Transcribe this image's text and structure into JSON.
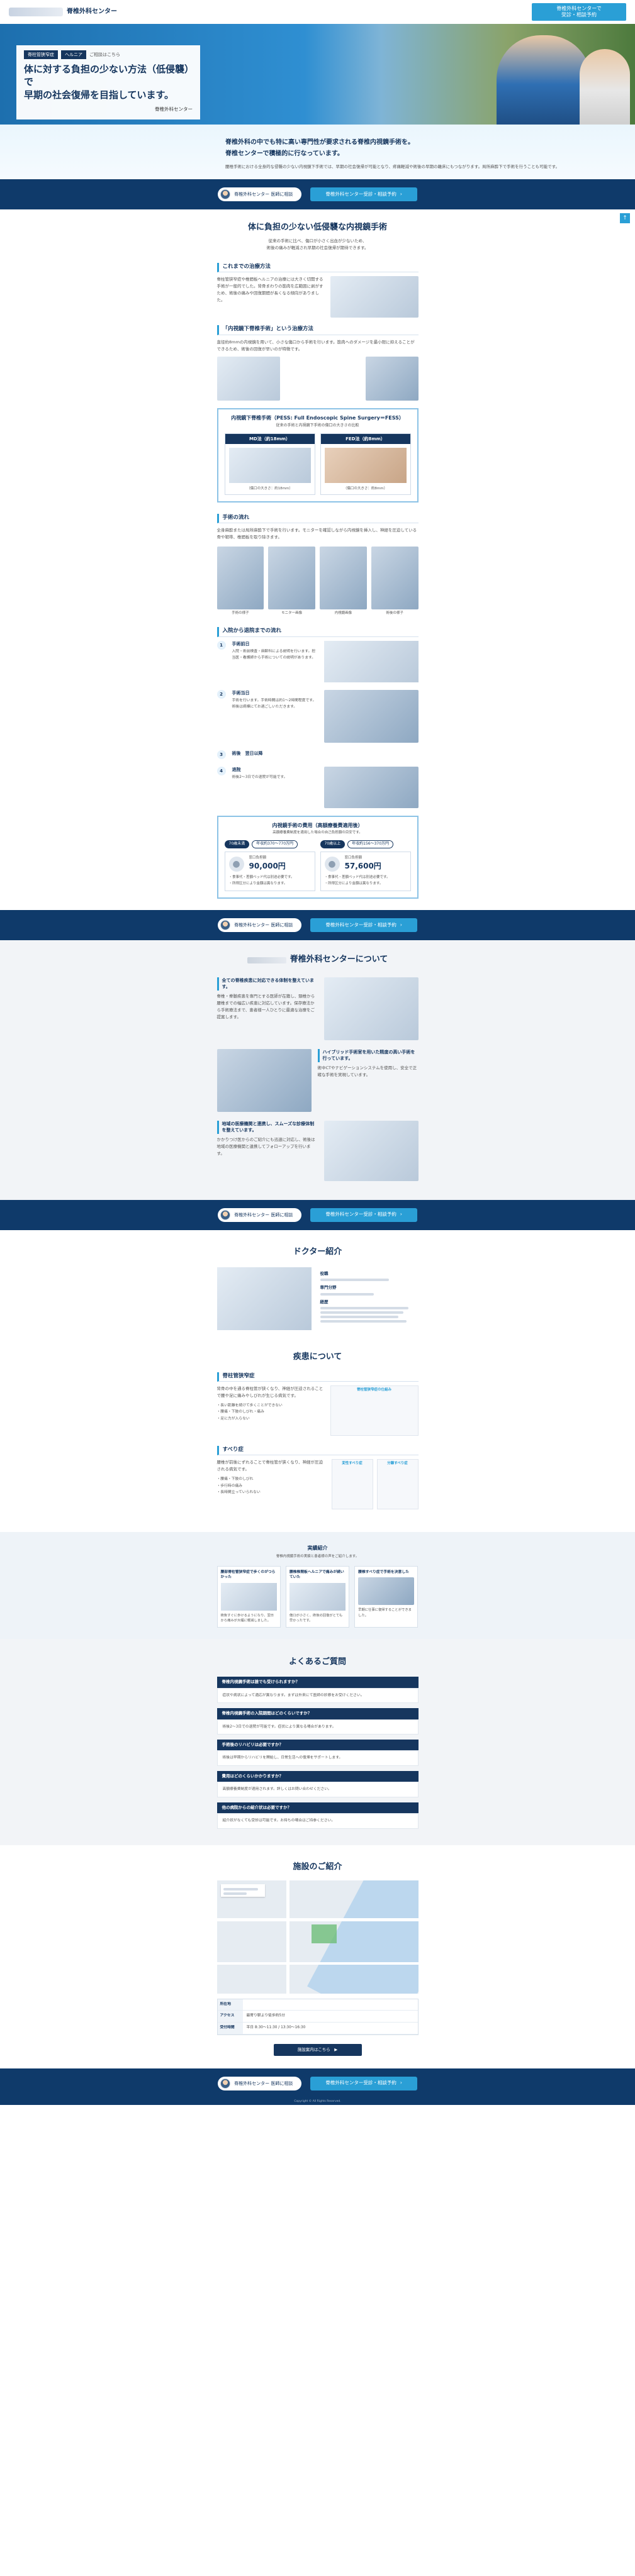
{
  "header": {
    "brand": "脊椎外科センター",
    "cta": "脊椎外科センターで\n受診・相談予約",
    "float_top": "↑"
  },
  "hero": {
    "tags": [
      "脊柱管狭窄症",
      "ヘルニア",
      "内視鏡手術"
    ],
    "tag_caption": "ご相談はこちら",
    "title": "体に対する負担の少ない方法（低侵襲）で\n早期の社会復帰を目指しています。",
    "footer": "脊椎外科センター"
  },
  "intro": {
    "lead": "脊椎外科の中でも特に高い専門性が要求される脊椎内視鏡手術を。\n脊椎センターで積極的に行なっています。",
    "body": "腰椎手術における全身的な侵襲の少ない内視鏡下手術では、早期の社会復帰が可能となり、疼痛軽減や術後の早期の離床にもつながります。局所麻酔下で手術を行うことも可能です。"
  },
  "cta": {
    "left": "脊椎外科センター 医師に相談",
    "right": "脊椎外科センター受診・相談予約"
  },
  "surgery": {
    "title": "体に負担の少ない低侵襲な内視鏡手術",
    "subtitle": "従来の手術に比べ、傷口が小さく出血が少ないため、\n術後の痛みが軽減され早期の社会復帰が期待できます。",
    "old_title": "これまでの治療方法",
    "old_text": "脊柱管狭窄症や椎間板ヘルニアの治療には大きく切開する手術が一般的でした。背骨まわりの筋肉を広範囲に剥がすため、術後の痛みや回復期間が長くなる傾向がありました。",
    "endo_title": "「内視鏡下脊椎手術」という治療方法",
    "endo_text": "直径約8mmの内視鏡を用いて、小さな傷口から手術を行います。筋肉へのダメージを最小限に抑えることができるため、術後の回復が早いのが特徴です。",
    "compare_title": "内視鏡下脊椎手術（PESS: Full Endoscopic Spine Surgery＝FESS）",
    "compare_sub": "従来の手術と内視鏡下手術の傷口の大きさの比較",
    "col1": "MD法（約18mm）",
    "col2": "FED法（約8mm）",
    "col1_cap": "（傷口の大きさ：約18mm）",
    "col2_cap": "（傷口の大きさ：約8mm）",
    "flow_title": "手術の流れ",
    "flow_text": "全身麻酔または局所麻酔下で手術を行います。モニターを確認しながら内視鏡を挿入し、神経を圧迫している骨や靭帯、椎間板を取り除きます。",
    "flow_caps": [
      "手術の様子",
      "モニター画像",
      "内視鏡画像",
      "術後の様子"
    ]
  },
  "steps": {
    "title": "入院から退院までの流れ",
    "items": [
      {
        "n": "1",
        "title": "手術前日",
        "text": "入院・術前検査・麻酔科による説明を行います。担当医・看護師から手術についての説明があります。"
      },
      {
        "n": "2",
        "title": "手術当日",
        "text": "手術を行います。手術時間は約1〜2時間程度です。術後は病棟にてお過ごしいただきます。"
      },
      {
        "n": "3",
        "title": "術後　翌日以降",
        "text": ""
      },
      {
        "n": "4",
        "title": "退院",
        "text": "術後2〜3日での退院が可能です。"
      }
    ]
  },
  "price": {
    "title": "内視鏡手術の費用（高額療養費適用後）",
    "subtitle": "高額療養費制度を適用した場合の自己負担額の目安です。",
    "col1_pills": [
      "70歳未満",
      "年収約370〜770万円"
    ],
    "col2_pills": [
      "70歳以上",
      "年収約156〜370万円"
    ],
    "label": "窓口負担額",
    "col1_amount": "90,000円",
    "col2_amount": "57,600円",
    "notes": "・食事代・差額ベッド代は別途必要です。\n・所得区分により金額は異なります。"
  },
  "about": {
    "title": "脊椎外科センターについて",
    "blocks": [
      {
        "title": "全ての脊椎疾患に対応できる体制を整えています。",
        "text": "脊椎・脊髄疾患を専門とする医師が在籍し、頸椎から腰椎までの幅広い疾患に対応しています。保存療法から手術療法まで、患者様一人ひとりに最適な治療をご提案します。"
      },
      {
        "title": "ハイブリッド手術室を用いた精度の高い手術を行っています。",
        "text": "術中CTやナビゲーションシステムを使用し、安全で正確な手術を実現しています。"
      },
      {
        "title": "地域の医療機関と連携し、スムーズな診療体制を整えています。",
        "text": "かかりつけ医からのご紹介にも迅速に対応し、術後は地域の医療機関と連携してフォローアップを行います。"
      }
    ]
  },
  "doctor": {
    "title": "ドクター紹介",
    "role_label": "役職",
    "name_label": "専門分野",
    "career_label": "経歴"
  },
  "disease": {
    "title": "疾患について",
    "d1_title": "脊柱管狭窄症",
    "d1_text": "背骨の中を通る脊柱管が狭くなり、神経が圧迫されることで腰や足に痛みやしびれが生じる病気です。",
    "d1_list": "・長い距離を続けて歩くことができない\n・腰痛・下肢のしびれ・痛み\n・足に力が入らない",
    "d1_diagram": "脊柱管狭窄症の仕組み",
    "d2_title": "すべり症",
    "d2_text": "腰椎が前後にずれることで脊柱管が狭くなり、神経が圧迫される病気です。",
    "d2_list": "・腰痛・下肢のしびれ\n・歩行時の痛み\n・長時間立っていられない",
    "d2_diag1": "変性すべり症",
    "d2_diag2": "分離すべり症"
  },
  "cases": {
    "title": "実績紹介",
    "subtitle": "脊椎内視鏡手術の実績と患者様の声をご紹介します。",
    "items": [
      {
        "h": "腰部脊柱管狭窄症で歩くのがつらかった",
        "t": "術後すぐに歩けるようになり、翌日から痛みが大幅に軽減しました。"
      },
      {
        "h": "腰椎椎間板ヘルニアで痛みが続いていた",
        "t": "傷口が小さく、術後の回復がとても早かったです。"
      },
      {
        "h": "腰椎すべり症で手術を決意した",
        "t": "早期に仕事に復帰することができました。"
      }
    ]
  },
  "faq": {
    "title": "よくあるご質問",
    "items": [
      {
        "q": "脊椎内視鏡手術は誰でも受けられますか？",
        "a": "症状や病状によって適応が異なります。まずは外来にて医師の診察をお受けください。"
      },
      {
        "q": "脊椎内視鏡手術の入院期間はどのくらいですか？",
        "a": "術後2〜3日での退院が可能です。症状により異なる場合があります。"
      },
      {
        "q": "手術後のリハビリは必要ですか？",
        "a": "術後は早期からリハビリを開始し、日常生活への復帰をサポートします。"
      },
      {
        "q": "費用はどのくらいかかりますか？",
        "a": "高額療養費制度が適用されます。詳しくはお問い合わせください。"
      },
      {
        "q": "他の病院からの紹介状は必要ですか？",
        "a": "紹介状がなくても受診は可能です。お持ちの場合はご持参ください。"
      }
    ]
  },
  "access": {
    "title": "施設のご紹介",
    "rows": [
      {
        "k": "所在地",
        "v": ""
      },
      {
        "k": "アクセス",
        "v": "最寄り駅より徒歩約5分"
      },
      {
        "k": "受付時間",
        "v": "平日 8:30〜11:30 / 13:30〜16:30"
      }
    ],
    "button": "施設案内はこちら　▶"
  },
  "footer": {
    "copyright": "Copyright © All Rights Reserved."
  }
}
